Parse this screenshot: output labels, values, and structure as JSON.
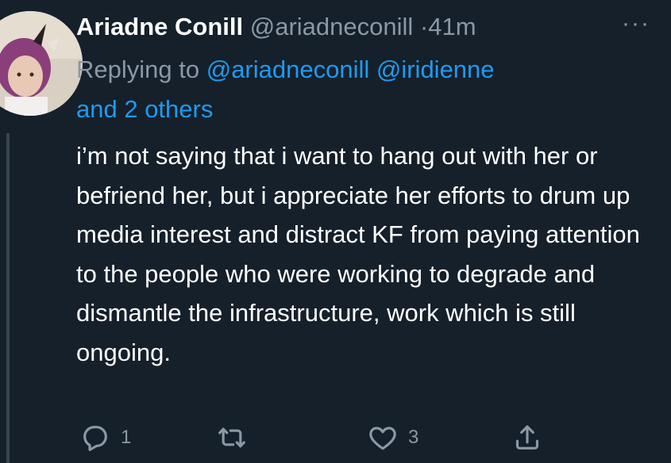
{
  "tweet": {
    "display_name": "Ariadne Conill",
    "handle": "@ariadneconill",
    "separator": "·",
    "timestamp": "41m",
    "replying_prefix": "Replying to",
    "mentions": [
      "@ariadneconill",
      "@iridienne"
    ],
    "others": "and 2 others",
    "text": "i’m not saying that i want to hang out with her or befriend her, but i appreciate her efforts to drum up media interest and distract KF from paying attention to the people who were working to degrade and dismantle the infrastructure, work which is still ongoing.",
    "more_glyph": "···"
  },
  "actions": {
    "reply_count": "1",
    "retweet_count": "",
    "like_count": "3"
  },
  "icons": {
    "reply": "reply-icon",
    "retweet": "retweet-icon",
    "like": "like-icon",
    "share": "share-icon",
    "more": "more-icon"
  },
  "colors": {
    "background": "#15202b",
    "text": "#ffffff",
    "secondary": "#8b98a5",
    "link": "#1d9bf0"
  }
}
